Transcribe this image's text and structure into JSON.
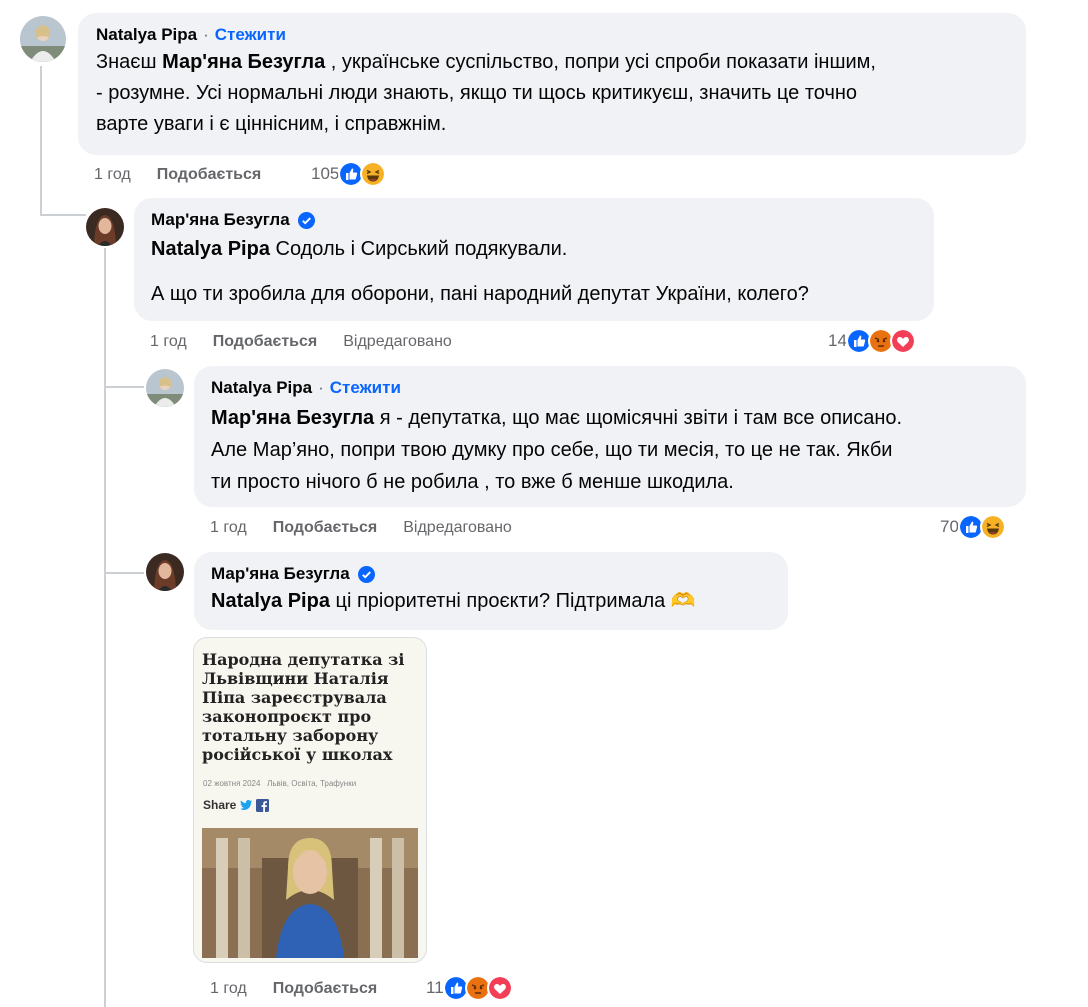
{
  "comments": [
    {
      "author": "Natalya Pipa",
      "follow": "Стежити",
      "lines": [
        {
          "pre": "Знаєш ",
          "mention": "Мар'яна Безугла",
          "post": " , українське суспільство, попри усі спроби показати іншим,"
        },
        {
          "text": "- розумне. Усі нормальні люди знають, якщо ти щось критикуєш, значить це точно"
        },
        {
          "text": "варте уваги і є ціннісним, і справжнім."
        }
      ],
      "time": "1 год",
      "like": "Подобається",
      "count": "105",
      "reactions": [
        "like-icon",
        "haha-icon"
      ]
    },
    {
      "author": "Мар'яна Безугла",
      "verified": true,
      "line1_mention": "Natalya Pipa",
      "line1_text": " Содоль і Сирський подякували.",
      "line2": "А що ти зробила для оборони, пані народний депутат України, колего?",
      "time": "1 год",
      "like": "Подобається",
      "edited": "Відредаговано",
      "count": "14",
      "reactions": [
        "like-icon",
        "angry-icon",
        "love-icon"
      ]
    },
    {
      "author": "Natalya Pipa",
      "follow": "Стежити",
      "lines": [
        {
          "mention": "Мар'яна Безугла",
          "post": " я - депутатка, що має щомісячні звіти і там все описано."
        },
        {
          "text": "Але Мар’яно, попри твою думку про себе, що ти месія, то це не так. Якби"
        },
        {
          "text": "ти просто нічого б не робила , то вже б менше шкодила."
        }
      ],
      "time": "1 год",
      "like": "Подобається",
      "edited": "Відредаговано",
      "count": "70",
      "reactions": [
        "like-icon",
        "haha-icon"
      ]
    },
    {
      "author": "Мар'яна Безугла",
      "verified": true,
      "mention": "Natalya Pipa",
      "text": " ці пріоритетні проєкти? Підтримала 🫶",
      "attachment": {
        "title": "Народна депутатка зі Львівщини Наталія Піпа зареєструвала законопроєкт про тотальну заборону російської у школах",
        "date": "02 жовтня 2024",
        "tags": "Львів, Освіта, Трафунки",
        "share": "Share"
      },
      "time": "1 год",
      "like": "Подобається",
      "count": "11",
      "reactions": [
        "like-icon",
        "angry-icon",
        "love-icon"
      ]
    }
  ],
  "colors": {
    "bubble": "#f0f2f5",
    "link": "#0866ff",
    "meta": "#65676b",
    "like": "#0866ff",
    "haha": "#f7b125",
    "angry": "#e9710f",
    "love": "#f33e58"
  }
}
